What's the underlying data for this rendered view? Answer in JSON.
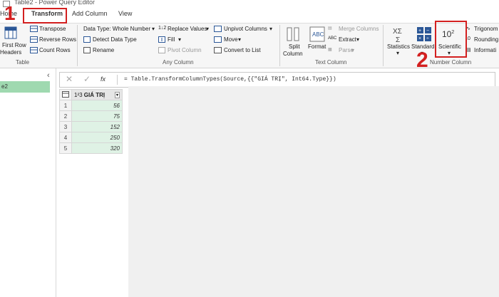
{
  "window": {
    "title": "Table2 - Power Query Editor"
  },
  "tabs": [
    {
      "label": "Home"
    },
    {
      "label": "Transform"
    },
    {
      "label": "Add Column"
    },
    {
      "label": "View"
    }
  ],
  "ribbon": {
    "table_group": {
      "first_row_headers_line1": "First Row",
      "first_row_headers_line2": "Headers",
      "transpose": "Transpose",
      "reverse_rows": "Reverse Rows",
      "count_rows": "Count Rows",
      "group_label": "Table"
    },
    "any_column_group": {
      "data_type": "Data Type: Whole Number",
      "detect_data_type": "Detect Data Type",
      "rename": "Rename",
      "replace_values": "Replace Values",
      "fill": "Fill",
      "pivot_column": "Pivot Column",
      "unpivot_columns": "Unpivot Columns",
      "move": "Move",
      "convert_to_list": "Convert to List",
      "group_label": "Any Column"
    },
    "text_column_group": {
      "split_column_line1": "Split",
      "split_column_line2": "Column",
      "format": "Format",
      "merge_columns": "Merge Columns",
      "extract": "Extract",
      "parse": "Parse",
      "group_label": "Text Column"
    },
    "number_column_group": {
      "statistics": "Statistics",
      "standard": "Standard",
      "scientific": "Scientific",
      "scientific_icon_text": "10",
      "scientific_icon_sup": "2",
      "trigonometry": "Trigonom",
      "rounding": "Rounding",
      "information": "Informati",
      "group_label": "Number Column"
    }
  },
  "annotations": {
    "marker_1": "1",
    "marker_2": "2"
  },
  "queries_pane": {
    "selected_item": "e2"
  },
  "formula_bar": {
    "fx": "fx",
    "formula": "= Table.TransformColumnTypes(Source,{{\"GIÁ TRỊ\", Int64.Type}})"
  },
  "table": {
    "type_icon": "1²3",
    "column_header": "GIÁ TRỊ",
    "rows": [
      {
        "num": "1",
        "value": "56"
      },
      {
        "num": "2",
        "value": "75"
      },
      {
        "num": "3",
        "value": "152"
      },
      {
        "num": "4",
        "value": "250"
      },
      {
        "num": "5",
        "value": "320"
      }
    ]
  },
  "colors": {
    "annotation_red": "#d32020",
    "selected_green": "#9fd9b0",
    "column_green": "#dff2e5"
  }
}
